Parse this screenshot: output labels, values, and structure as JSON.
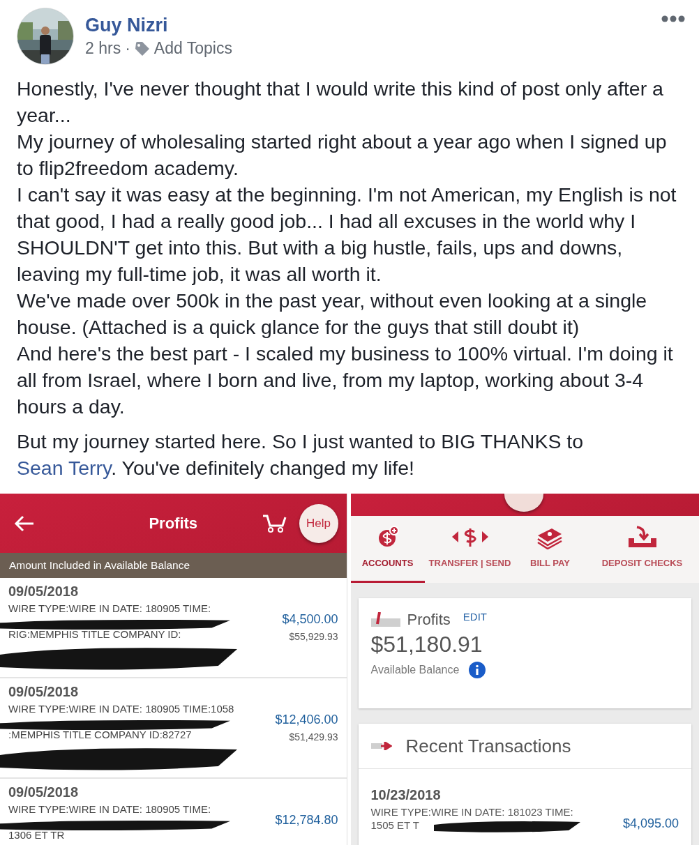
{
  "post": {
    "author": "Guy Nizri",
    "time": "2 hrs",
    "separator": "·",
    "topics_link": "Add Topics",
    "paragraphs": [
      "Honestly, I've never thought that I would write this kind of post only after a year...",
      "My journey of wholesaling started right about a year ago when I signed up to flip2freedom academy.",
      "I can't say it was easy at the beginning. I'm not American, my English is not that good, I had a really good job... I had all excuses in the world why I SHOULDN'T get into this. But with a big hustle, fails, ups and downs, leaving my full-time job, it was all worth it.",
      "We've made over 500k in the past year, without even looking at a single house. (Attached is a quick glance for the guys that still doubt it)",
      "And here's the best part - I scaled my business to 100% virtual. I'm doing it all from Israel, where I born and live, from my laptop, working about 3-4 hours a day."
    ],
    "closing": {
      "before": "But my journey started here. So I just wanted to BIG THANKS to ",
      "link": "Sean Terry",
      "after": ". You've definitely changed my life!"
    }
  },
  "screenshot_left": {
    "title": "Profits",
    "help": "Help",
    "banner": "Amount Included in Available Balance",
    "transactions": [
      {
        "date": "09/05/2018",
        "lines": [
          "WIRE TYPE:WIRE IN DATE: 180905 TIME:",
          "RIG:MEMPHIS TITLE COMPANY ID:"
        ],
        "amount": "$4,500.00",
        "balance": "$55,929.93"
      },
      {
        "date": "09/05/2018",
        "lines": [
          "WIRE TYPE:WIRE IN DATE: 180905 TIME:1058",
          ":MEMPHIS TITLE COMPANY ID:82727"
        ],
        "amount": "$12,406.00",
        "balance": "$51,429.93"
      },
      {
        "date": "09/05/2018",
        "lines": [
          "WIRE TYPE:WIRE IN DATE: 180905 TIME:",
          "1306 ET TR"
        ],
        "amount": "$12,784.80"
      }
    ]
  },
  "screenshot_right": {
    "tabs": [
      {
        "label": "ACCOUNTS",
        "kind": "accounts",
        "selected": true
      },
      {
        "label": "TRANSFER | SEND",
        "kind": "transfer",
        "selected": false
      },
      {
        "label": "BILL PAY",
        "kind": "billpay",
        "selected": false
      },
      {
        "label": "DEPOSIT CHECKS",
        "kind": "deposit",
        "selected": false
      }
    ],
    "account": {
      "name": "Profits",
      "edit": "EDIT",
      "balance": "$51,180.91",
      "balance_label": "Available Balance"
    },
    "recent": {
      "title": "Recent Transactions",
      "transactions": [
        {
          "date": "10/23/2018",
          "lines": [
            "WIRE TYPE:WIRE IN DATE: 181023 TIME:",
            "1505 ET T"
          ],
          "amount": "$4,095.00"
        }
      ]
    }
  }
}
